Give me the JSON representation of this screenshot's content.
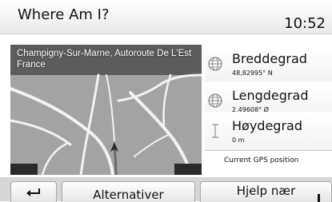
{
  "header": {
    "title": "Where Am I?",
    "time": "10:52"
  },
  "map": {
    "location_label": "Champigny-Sur-Marne, Autoroute De L'Est France"
  },
  "info": [
    {
      "label": "Breddegrad",
      "value": "48,82995° N",
      "icon": "globe-icon"
    },
    {
      "label": "Lengdegrad",
      "value": "2,49608° Ø",
      "icon": "globe-icon"
    },
    {
      "label": "Høydegrad",
      "value": "0 m",
      "icon": "altitude-icon"
    }
  ],
  "gps_button": {
    "label": "Current GPS position"
  },
  "bottom_bar": {
    "back_icon": "back-arrow-icon",
    "alternatives_label": "Alternativer",
    "help_label": "Hjelp nær"
  }
}
